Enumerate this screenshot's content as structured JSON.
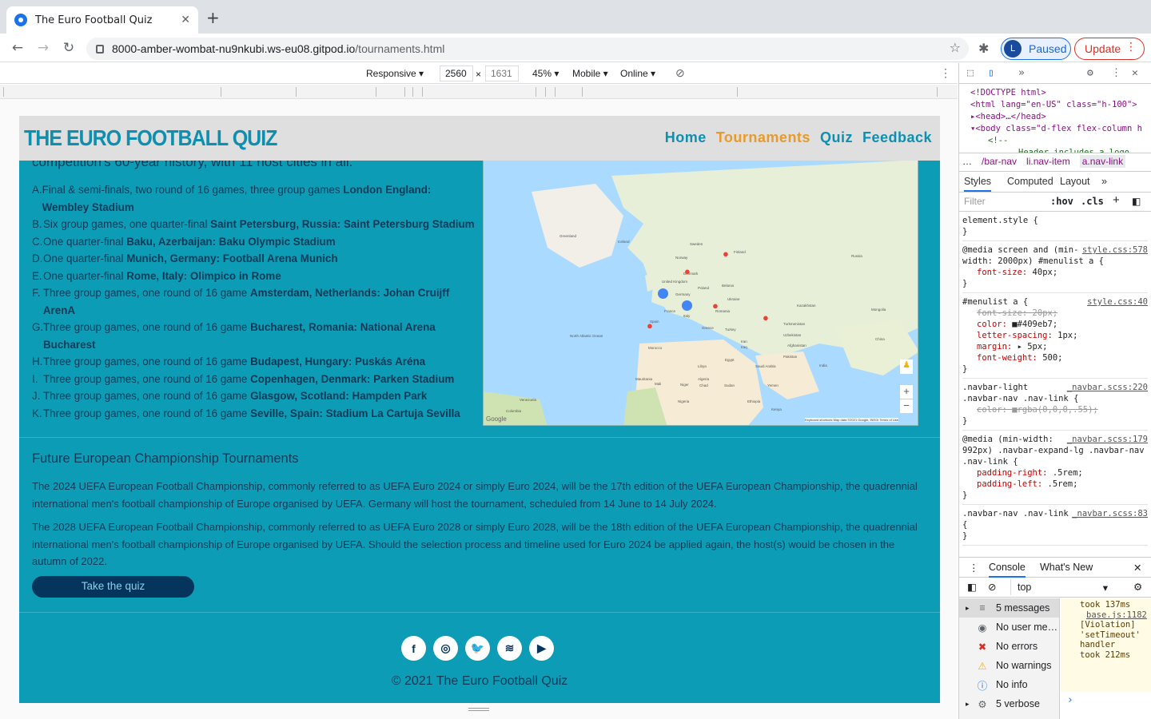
{
  "browser": {
    "tab_title": "The Euro Football Quiz",
    "tab_close": "✕",
    "new_tab": "+",
    "url_host": "8000-amber-wombat-nu9nkubi.ws-eu08.gitpod.io",
    "url_path": "/tournaments.html",
    "profile_initial": "L",
    "profile_label": "Paused",
    "update_label": "Update"
  },
  "device_toolbar": {
    "mode": "Responsive ▾",
    "width": "2560",
    "times": "×",
    "height": "1631",
    "zoom": "45% ▾",
    "device": "Mobile ▾",
    "network": "Online ▾"
  },
  "site": {
    "logo": "THE EURO FOOTBALL QUIZ",
    "nav": [
      {
        "label": "Home",
        "active": false
      },
      {
        "label": "Tournaments",
        "active": true
      },
      {
        "label": "Quiz",
        "active": false
      },
      {
        "label": "Feedback",
        "active": false
      }
    ],
    "intro_fragment": "competition's 60-year history, with 11 host cities in all.",
    "cities": [
      {
        "k": "A.",
        "text": "Final & semi-finals, two round of 16 games, three group games ",
        "bold": "London England: Wembley Stadium"
      },
      {
        "k": "B.",
        "text": "Six group games, one quarter-final ",
        "bold": "Saint Petersburg, Russia: Saint Petersburg Stadium"
      },
      {
        "k": "C.",
        "text": "One quarter-final ",
        "bold": "Baku, Azerbaijan: Baku Olympic Stadium"
      },
      {
        "k": "D.",
        "text": "One quarter-final ",
        "bold": "Munich, Germany: Football Arena Munich"
      },
      {
        "k": "E.",
        "text": "One quarter-final ",
        "bold": "Rome, Italy: Olimpico in Rome"
      },
      {
        "k": "F.",
        "text": "Three group games, one round of 16 game ",
        "bold": "Amsterdam, Netherlands: Johan Cruijff ArenA"
      },
      {
        "k": "G.",
        "text": "Three group games, one round of 16 game ",
        "bold": "Bucharest, Romania: National Arena Bucharest"
      },
      {
        "k": "H.",
        "text": "Three group games, one round of 16 game ",
        "bold": "Budapest, Hungary: Puskás Aréna"
      },
      {
        "k": "I.",
        "text": "Three group games, one round of 16 game ",
        "bold": "Copenhagen, Denmark: Parken Stadium"
      },
      {
        "k": "J.",
        "text": "Three group games, one round of 16 game ",
        "bold": "Glasgow, Scotland: Hampden Park"
      },
      {
        "k": "K.",
        "text": "Three group games, one round of 16 game ",
        "bold": "Seville, Spain: Stadium La Cartuja Sevilla"
      }
    ],
    "map_labels": [
      "Greenland",
      "Iceland",
      "Sweden",
      "Finland",
      "Norway",
      "Russia",
      "Kazakhstan",
      "Mongolia",
      "China",
      "India",
      "Iran",
      "Turkey",
      "Egypt",
      "Algeria",
      "Libya",
      "Mali",
      "Niger",
      "Chad",
      "Sudan",
      "Nigeria",
      "Ethiopia",
      "Kenya",
      "Saudi Arabia",
      "Pakistan",
      "Afghanistan",
      "France",
      "Spain",
      "Germany",
      "Ukraine",
      "Poland",
      "Belarus",
      "Morocco",
      "Mauritania",
      "Venezuela",
      "Colombia",
      "North Atlantic Ocean",
      "Yemen",
      "Uzbekistan",
      "Turkmenistan",
      "Iraq",
      "Greece",
      "Italy",
      "Romania",
      "Denmark",
      "United Kingdom"
    ],
    "map_footer_google": "Google",
    "map_footer_terms": "Keyboard shortcuts   Map data ©2021 Google, INEGI   Terms of Use",
    "future_title": "Future European Championship Tournaments",
    "future_p1": "The 2024 UEFA European Football Championship, commonly referred to as UEFA Euro 2024 or simply Euro 2024, will be the 17th edition of the UEFA European Championship, the quadrennial international men's football championship of Europe organised by UEFA. Germany will host the tournament, scheduled from 14 June to 14 July 2024.",
    "future_p2": "The 2028 UEFA European Football Championship, commonly referred to as UEFA Euro 2028 or simply Euro 2028, will be the 18th edition of the UEFA European Championship, the quadrennial international men's football championship of Europe organised by UEFA. Should the selection process and timeline used for Euro 2024 be applied again, the host(s) would be chosen in the autumn of 2022.",
    "quiz_button": "Take the quiz",
    "social": [
      "f",
      "◎",
      "🐦",
      "≋",
      "▶"
    ],
    "copyright": "© 2021 The Euro Football Quiz"
  },
  "devtools": {
    "elements_tab": "»",
    "src_lines": [
      "<!DOCTYPE html>",
      "<html lang=\"en-US\" class=\"h-100\">",
      "▸<head>…</head>",
      "▾<body class=\"d-flex flex-column h",
      "<!--",
      "Header includes a logo"
    ],
    "crumbs": [
      "…",
      "/bar-nav",
      "li.nav-item",
      "a.nav-link"
    ],
    "tabs": [
      "Styles",
      "Computed",
      "Layout",
      "»"
    ],
    "filter": "Filter",
    "hov": ":hov",
    "cls": ".cls",
    "rules": [
      {
        "sel": "element.style {",
        "lnk": "",
        "props": []
      },
      {
        "sel": "@media screen and (min-width: 2000px) #menulist a {",
        "lnk": "style.css:578",
        "props": [
          {
            "p": "font-size",
            "v": "40px;",
            "strike": false
          }
        ]
      },
      {
        "sel": "#menulist a {",
        "lnk": "style.css:40",
        "props": [
          {
            "p": "font-size",
            "v": "20px;",
            "strike": true
          },
          {
            "p": "color",
            "v": "■#409eb7;",
            "strike": false
          },
          {
            "p": "letter-spacing",
            "v": "1px;",
            "strike": false
          },
          {
            "p": "margin",
            "v": "▸ 5px;",
            "strike": false
          },
          {
            "p": "font-weight",
            "v": "500;",
            "strike": false
          }
        ]
      },
      {
        "sel": ".navbar-light .navbar-nav .nav-link {",
        "lnk": "_navbar.scss:220",
        "props": [
          {
            "p": "color",
            "v": "■rgba(0,0,0,.55);",
            "strike": true
          }
        ]
      },
      {
        "sel": "@media (min-width: 992px) .navbar-expand-lg .navbar-nav .nav-link {",
        "lnk": "_navbar.scss:179",
        "props": [
          {
            "p": "padding-right",
            "v": ".5rem;",
            "strike": false
          },
          {
            "p": "padding-left",
            "v": ".5rem;",
            "strike": false
          }
        ]
      },
      {
        "sel": ".navbar-nav .nav-link {",
        "lnk": "_navbar.scss:83",
        "props": []
      }
    ],
    "console_tab": "Console",
    "whatsnew_tab": "What's New",
    "context": "top",
    "side_items": [
      {
        "icon": "≡",
        "label": "5 messages",
        "arrow": "▸"
      },
      {
        "icon": "◉",
        "label": "No user me…",
        "arrow": ""
      },
      {
        "icon": "✖",
        "label": "No errors",
        "arrow": ""
      },
      {
        "icon": "⚠",
        "label": "No warnings",
        "arrow": ""
      },
      {
        "icon": "ⓘ",
        "label": "No info",
        "arrow": ""
      },
      {
        "icon": "⚙",
        "label": "5 verbose",
        "arrow": "▸"
      }
    ],
    "log_lines": [
      "took 137ms",
      "base.js:1182",
      "[Violation]",
      "'setTimeout' handler",
      "took 212ms"
    ],
    "prompt": "›"
  }
}
